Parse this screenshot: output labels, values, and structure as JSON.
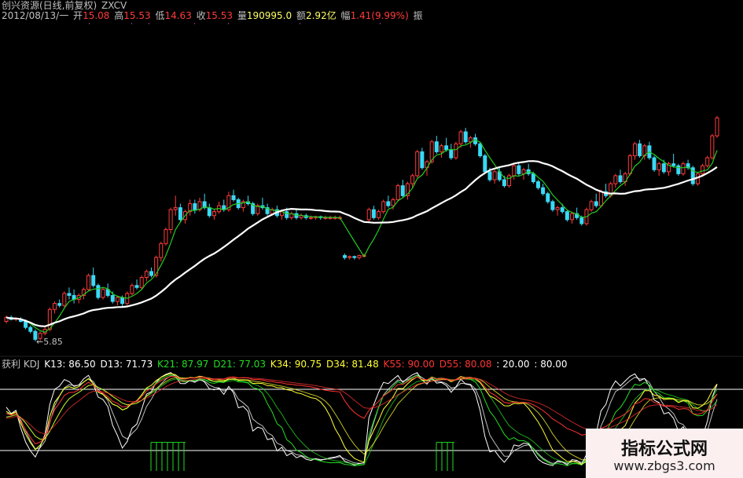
{
  "title": {
    "stock": "创兴资源(日线,前复权)",
    "indicator": "ZXCV"
  },
  "info": {
    "date": "2012/08/13/一",
    "open_label": "开",
    "open": "15.08",
    "high_label": "高",
    "high": "15.53",
    "low_label": "低",
    "low": "14.63",
    "close_label": "收",
    "close": "15.53",
    "volume_label": "量",
    "volume": "190995.0",
    "amount_label": "额",
    "amount": "2.92亿",
    "change_label": "幅",
    "change": "1.41(9.99%)",
    "extra": "振"
  },
  "price_annotation": "5.85",
  "kdj": {
    "name": "获利 KDJ",
    "items": [
      {
        "text": "K13: 86.50",
        "color": "#ffffff"
      },
      {
        "text": "D13: 71.73",
        "color": "#ffffff"
      },
      {
        "text": "K21: 87.97",
        "color": "#22dd22"
      },
      {
        "text": "D21: 77.03",
        "color": "#22dd22"
      },
      {
        "text": "K34: 90.75",
        "color": "#ffff33"
      },
      {
        "text": "D34: 81.48",
        "color": "#ffff33"
      },
      {
        "text": "K55: 90.00",
        "color": "#ff3333"
      },
      {
        "text": "D55: 80.08",
        "color": "#ff3333"
      },
      {
        "text": ": 20.00",
        "color": "#ffffff"
      },
      {
        "text": ": 80.00",
        "color": "#ffffff"
      }
    ]
  },
  "watermark": {
    "title": "指标公式网",
    "url": "www.zbgs3.com"
  },
  "colors": {
    "up": "#ff3b3b",
    "down": "#39d9f5",
    "ma_short": "#22cc22",
    "ma_long": "#ffffff",
    "label": "#c0c0c0",
    "value": "#ff3b3b"
  },
  "chart_data": {
    "type": "candlestick",
    "candles": [
      [
        5.9,
        6.2,
        5.8,
        6.1
      ],
      [
        6.1,
        6.2,
        5.95,
        6.0
      ],
      [
        6.0,
        6.1,
        5.9,
        6.05
      ],
      [
        6.0,
        6.1,
        5.85,
        5.9
      ],
      [
        5.9,
        6.0,
        5.5,
        5.6
      ],
      [
        5.6,
        5.7,
        5.3,
        5.4
      ],
      [
        5.4,
        5.5,
        4.9,
        5.0
      ],
      [
        5.05,
        5.4,
        4.85,
        5.3
      ],
      [
        5.3,
        5.6,
        5.2,
        5.5
      ],
      [
        5.5,
        6.6,
        5.4,
        6.5
      ],
      [
        6.5,
        6.9,
        6.3,
        6.8
      ],
      [
        6.8,
        7.0,
        6.6,
        6.7
      ],
      [
        6.7,
        7.4,
        6.6,
        7.3
      ],
      [
        7.3,
        7.6,
        7.0,
        7.2
      ],
      [
        7.2,
        7.5,
        6.8,
        7.0
      ],
      [
        7.0,
        7.3,
        6.8,
        7.2
      ],
      [
        7.2,
        7.6,
        7.0,
        7.5
      ],
      [
        7.5,
        8.3,
        7.4,
        8.2
      ],
      [
        8.2,
        8.6,
        7.6,
        7.7
      ],
      [
        7.7,
        7.8,
        7.0,
        7.1
      ],
      [
        7.1,
        7.6,
        7.0,
        7.5
      ],
      [
        7.5,
        7.8,
        7.1,
        7.2
      ],
      [
        7.2,
        7.4,
        6.8,
        6.9
      ],
      [
        6.9,
        7.2,
        6.7,
        7.1
      ],
      [
        7.1,
        7.2,
        6.6,
        6.8
      ],
      [
        6.8,
        7.4,
        6.7,
        7.3
      ],
      [
        7.3,
        7.8,
        7.2,
        7.7
      ],
      [
        7.7,
        8.0,
        7.5,
        7.6
      ],
      [
        7.6,
        8.2,
        7.5,
        8.1
      ],
      [
        8.1,
        8.5,
        7.9,
        8.4
      ],
      [
        8.4,
        8.6,
        8.1,
        8.2
      ],
      [
        8.2,
        9.2,
        8.1,
        9.1
      ],
      [
        9.1,
        9.9,
        8.9,
        9.8
      ],
      [
        9.8,
        10.6,
        9.7,
        10.5
      ],
      [
        10.5,
        11.6,
        10.3,
        11.5
      ],
      [
        11.5,
        12.2,
        11.2,
        11.6
      ],
      [
        11.6,
        11.8,
        10.9,
        11.0
      ],
      [
        11.0,
        11.5,
        10.8,
        11.4
      ],
      [
        11.4,
        12.0,
        11.2,
        11.8
      ],
      [
        11.8,
        12.0,
        11.3,
        11.5
      ],
      [
        11.5,
        12.1,
        11.4,
        11.9
      ],
      [
        11.9,
        12.3,
        11.5,
        11.6
      ],
      [
        11.6,
        11.8,
        11.1,
        11.2
      ],
      [
        11.2,
        11.5,
        11.0,
        11.4
      ],
      [
        11.4,
        11.9,
        11.3,
        11.7
      ],
      [
        11.7,
        12.0,
        11.4,
        11.5
      ],
      [
        11.5,
        12.4,
        11.4,
        12.2
      ],
      [
        12.2,
        12.5,
        11.9,
        12.0
      ],
      [
        12.0,
        12.1,
        11.5,
        11.6
      ],
      [
        11.6,
        12.0,
        11.4,
        11.9
      ],
      [
        11.9,
        12.2,
        11.7,
        11.8
      ],
      [
        11.8,
        11.9,
        11.2,
        11.3
      ],
      [
        11.3,
        11.8,
        11.2,
        11.7
      ],
      [
        11.7,
        12.1,
        11.5,
        11.6
      ],
      [
        11.6,
        11.8,
        11.2,
        11.3
      ],
      [
        11.3,
        11.6,
        11.2,
        11.5
      ],
      [
        11.5,
        11.7,
        11.1,
        11.2
      ],
      [
        11.2,
        11.5,
        11.0,
        11.4
      ],
      [
        11.4,
        11.6,
        11.0,
        11.1
      ],
      [
        11.1,
        11.4,
        11.0,
        11.3
      ],
      [
        11.3,
        11.5,
        11.0,
        11.1
      ],
      [
        11.1,
        11.3,
        11.0,
        11.2
      ],
      [
        11.2,
        11.3,
        11.0,
        11.1
      ],
      [
        11.1,
        11.2,
        11.0,
        11.1
      ],
      [
        11.1,
        11.2,
        11.0,
        11.15
      ],
      [
        11.15,
        11.2,
        11.0,
        11.1
      ],
      [
        11.1,
        11.2,
        11.0,
        11.1
      ],
      [
        11.1,
        11.2,
        11.0,
        11.1
      ],
      [
        11.1,
        11.2,
        11.0,
        11.1
      ],
      [
        11.1,
        11.2,
        11.0,
        11.1
      ],
      [
        9.2,
        9.3,
        9.0,
        9.1
      ],
      [
        9.1,
        9.2,
        9.0,
        9.15
      ],
      [
        9.15,
        9.2,
        9.0,
        9.1
      ],
      [
        9.1,
        9.25,
        9.0,
        9.2
      ],
      [
        9.2,
        9.3,
        9.1,
        9.2
      ],
      [
        11.0,
        11.6,
        10.9,
        11.5
      ],
      [
        11.5,
        11.7,
        11.0,
        11.1
      ],
      [
        11.1,
        11.5,
        11.0,
        11.4
      ],
      [
        11.4,
        12.0,
        11.3,
        11.9
      ],
      [
        11.9,
        12.2,
        11.6,
        11.7
      ],
      [
        11.7,
        12.1,
        11.5,
        12.0
      ],
      [
        12.0,
        12.8,
        11.9,
        12.7
      ],
      [
        12.7,
        13.0,
        12.1,
        12.2
      ],
      [
        12.2,
        12.9,
        12.0,
        12.8
      ],
      [
        12.8,
        13.3,
        12.6,
        13.2
      ],
      [
        13.2,
        14.5,
        13.1,
        14.4
      ],
      [
        14.4,
        14.6,
        13.5,
        13.6
      ],
      [
        13.6,
        14.0,
        13.2,
        13.9
      ],
      [
        13.9,
        15.0,
        13.8,
        14.9
      ],
      [
        14.9,
        15.2,
        14.3,
        14.4
      ],
      [
        14.4,
        14.8,
        14.1,
        14.7
      ],
      [
        14.7,
        15.1,
        14.4,
        14.5
      ],
      [
        14.5,
        14.8,
        14.0,
        14.1
      ],
      [
        14.1,
        14.9,
        14.0,
        14.8
      ],
      [
        14.8,
        15.5,
        14.6,
        15.4
      ],
      [
        15.4,
        15.6,
        14.8,
        14.9
      ],
      [
        14.9,
        15.2,
        14.6,
        15.1
      ],
      [
        15.1,
        15.3,
        14.7,
        14.8
      ],
      [
        14.8,
        14.9,
        14.1,
        14.2
      ],
      [
        14.2,
        14.3,
        13.3,
        13.4
      ],
      [
        13.4,
        13.6,
        12.9,
        13.0
      ],
      [
        13.0,
        13.5,
        12.8,
        13.4
      ],
      [
        13.4,
        13.6,
        12.9,
        13.0
      ],
      [
        13.0,
        13.2,
        12.6,
        12.7
      ],
      [
        12.7,
        13.3,
        12.6,
        13.2
      ],
      [
        13.2,
        13.8,
        13.0,
        13.7
      ],
      [
        13.7,
        13.9,
        13.2,
        13.3
      ],
      [
        13.3,
        13.6,
        13.0,
        13.5
      ],
      [
        13.5,
        13.8,
        13.2,
        13.3
      ],
      [
        13.3,
        13.4,
        12.8,
        12.9
      ],
      [
        12.9,
        13.0,
        12.5,
        12.6
      ],
      [
        12.6,
        12.8,
        12.2,
        12.3
      ],
      [
        12.3,
        12.4,
        11.8,
        11.9
      ],
      [
        11.9,
        12.0,
        11.4,
        11.5
      ],
      [
        11.5,
        11.7,
        11.2,
        11.6
      ],
      [
        11.6,
        11.8,
        11.3,
        11.4
      ],
      [
        11.4,
        11.5,
        10.9,
        11.0
      ],
      [
        11.0,
        11.4,
        10.8,
        11.3
      ],
      [
        11.3,
        11.6,
        11.0,
        11.1
      ],
      [
        11.1,
        11.2,
        10.7,
        10.8
      ],
      [
        10.8,
        11.6,
        10.7,
        11.5
      ],
      [
        11.5,
        12.0,
        11.4,
        11.9
      ],
      [
        11.9,
        12.3,
        11.6,
        11.7
      ],
      [
        11.7,
        12.5,
        11.6,
        12.4
      ],
      [
        12.4,
        12.8,
        12.1,
        12.2
      ],
      [
        12.2,
        12.9,
        12.1,
        12.8
      ],
      [
        12.8,
        13.3,
        12.6,
        13.2
      ],
      [
        13.2,
        13.5,
        12.8,
        12.9
      ],
      [
        12.9,
        13.4,
        12.7,
        13.3
      ],
      [
        13.3,
        14.3,
        13.2,
        14.2
      ],
      [
        14.2,
        14.9,
        14.0,
        14.8
      ],
      [
        14.8,
        15.0,
        14.1,
        14.2
      ],
      [
        14.2,
        14.8,
        14.0,
        14.7
      ],
      [
        14.7,
        14.9,
        14.0,
        14.1
      ],
      [
        14.1,
        14.2,
        13.4,
        13.5
      ],
      [
        13.5,
        13.9,
        13.2,
        13.8
      ],
      [
        13.8,
        14.0,
        13.3,
        13.4
      ],
      [
        13.4,
        13.9,
        13.2,
        13.8
      ],
      [
        13.8,
        14.3,
        13.6,
        13.7
      ],
      [
        13.7,
        13.8,
        13.2,
        13.3
      ],
      [
        13.3,
        13.9,
        13.2,
        13.8
      ],
      [
        13.8,
        14.0,
        13.5,
        13.6
      ],
      [
        13.6,
        13.7,
        12.7,
        12.8
      ],
      [
        12.8,
        13.4,
        12.7,
        13.3
      ],
      [
        13.3,
        13.8,
        13.2,
        13.7
      ],
      [
        13.7,
        14.2,
        13.6,
        14.1
      ],
      [
        14.1,
        15.3,
        14.0,
        15.2
      ],
      [
        15.2,
        16.2,
        15.1,
        16.1
      ]
    ],
    "ylabel": "",
    "annotations": [
      "5.85"
    ]
  }
}
